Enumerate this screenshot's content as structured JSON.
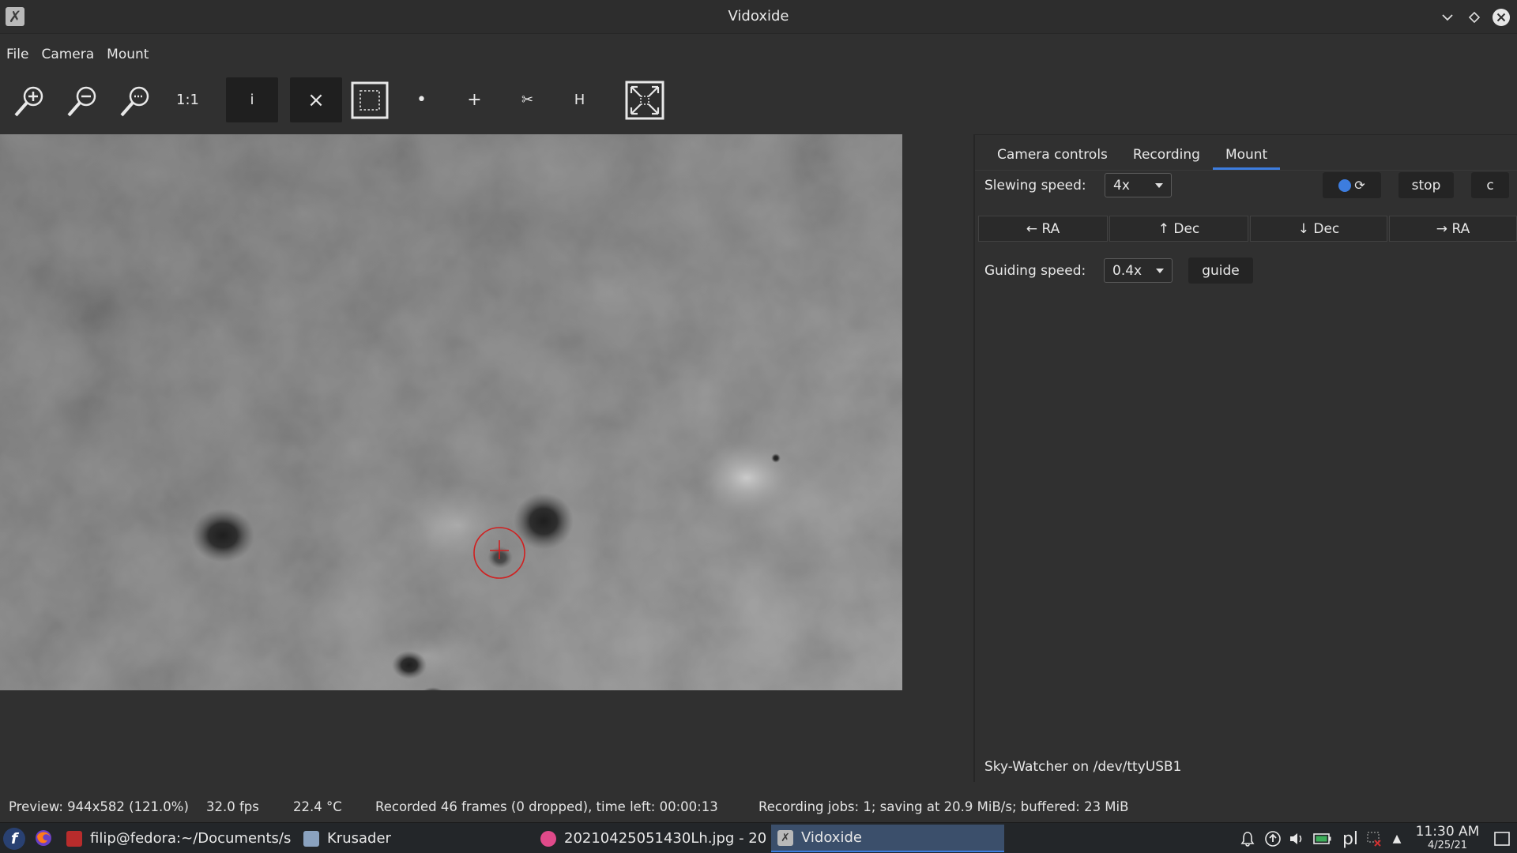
{
  "window": {
    "title": "Vidoxide"
  },
  "menu": [
    "File",
    "Camera",
    "Mount"
  ],
  "toolbar": {
    "zoom_in": "zoom-in-icon",
    "zoom_out": "zoom-out-icon",
    "zoom_fit": "zoom-fit-icon",
    "one_to_one": "1:1",
    "info": "i",
    "close": "×",
    "select_roi": "select-region-icon",
    "dot": "•",
    "cross": "+",
    "scissors": "✂",
    "histogram": "H",
    "fullscreen": "fullscreen-icon"
  },
  "tabs": [
    {
      "label": "Camera controls",
      "active": false
    },
    {
      "label": "Recording",
      "active": false
    },
    {
      "label": "Mount",
      "active": true
    }
  ],
  "mount": {
    "slewing_label": "Slewing speed:",
    "slewing_value": "4x",
    "sync_icon": "⟳",
    "stop_label": "stop",
    "c_label": "c",
    "ra_left": "← RA",
    "dec_up": "↑ Dec",
    "dec_down": "↓ Dec",
    "ra_right": "→ RA",
    "guiding_label": "Guiding speed:",
    "guiding_value": "0.4x",
    "guide_label": "guide",
    "device": "Sky-Watcher on /dev/ttyUSB1"
  },
  "status": {
    "preview": "Preview: 944x582 (121.0%)",
    "fps": "32.0 fps",
    "temp": "22.4 °C",
    "recorded": "Recorded 46 frames (0 dropped), time left: 00:00:13",
    "jobs": "Recording jobs: 1; saving at 20.9 MiB/s; buffered: 23 MiB"
  },
  "taskbar": {
    "tasks": [
      {
        "label": "filip@fedora:~/Documents/s...",
        "icon": "terminal-icon"
      },
      {
        "label": "Krusader",
        "icon": "krusader-icon"
      },
      {
        "label": "20210425051430Lh.jpg - 20...",
        "icon": "image-viewer-icon"
      },
      {
        "label": "Vidoxide",
        "icon": "vidoxide-icon",
        "active": true
      }
    ],
    "keyboard_layout": "pl",
    "time": "11:30 AM",
    "date": "4/25/21"
  },
  "colors": {
    "accent": "#3d7ddf",
    "window_bg": "#303030",
    "reticle": "#d02020"
  }
}
